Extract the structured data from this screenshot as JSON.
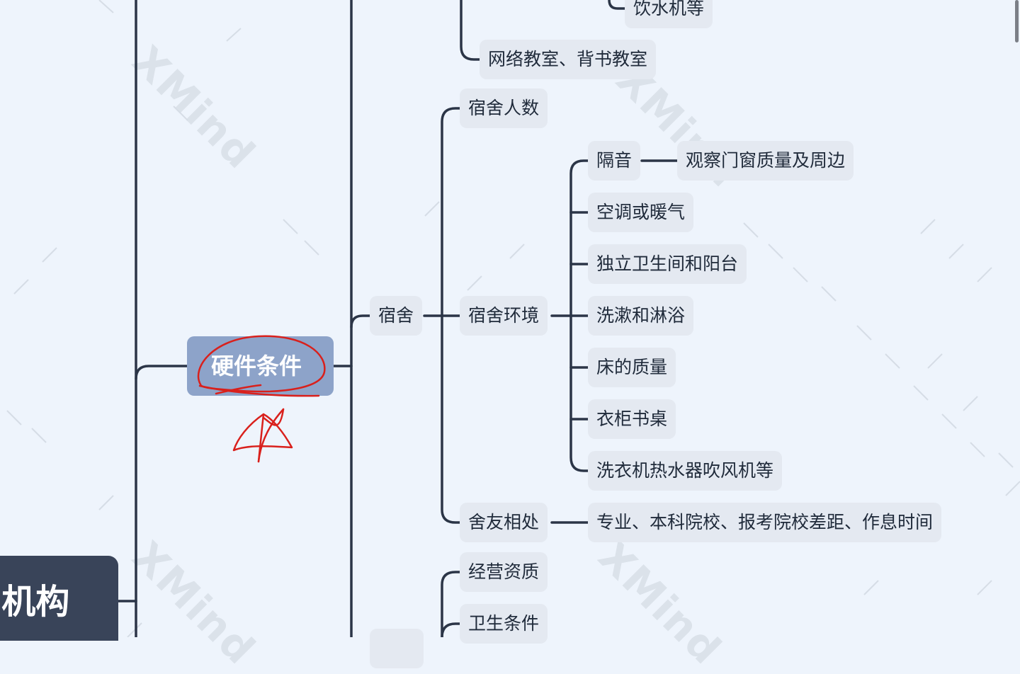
{
  "app": {
    "name": "XMind",
    "watermark": "XMind"
  },
  "root": {
    "label": "机构",
    "label_full_visible": "·机构"
  },
  "branches": {
    "hardware": {
      "label": "硬件条件",
      "annotation": "red-circle-and-star"
    },
    "facilities_partial": [
      {
        "label": "饮水机等"
      },
      {
        "label": "网络教室、背书教室"
      }
    ],
    "dorm": {
      "label": "宿舍",
      "children": [
        {
          "label": "宿舍人数"
        },
        {
          "label": "宿舍环境",
          "children": [
            {
              "label": "隔音",
              "detail": "观察门窗质量及周边"
            },
            {
              "label": "空调或暖气"
            },
            {
              "label": "独立卫生间和阳台"
            },
            {
              "label": "洗漱和淋浴"
            },
            {
              "label": "床的质量"
            },
            {
              "label": "衣柜书桌"
            },
            {
              "label": "洗衣机热水器吹风机等"
            }
          ]
        },
        {
          "label": "舍友相处",
          "detail": "专业、本科院校、报考院校差距、作息时间"
        }
      ]
    },
    "next_group": {
      "children": [
        {
          "label": "经营资质"
        },
        {
          "label": "卫生条件"
        }
      ]
    }
  },
  "colors": {
    "background": "#eef4fc",
    "line": "#2b3547",
    "topic_bg": "#e4e9f1",
    "selected_topic_bg": "#8da3c9",
    "root_bg": "#394459",
    "annotation_ink": "#d9201c"
  }
}
